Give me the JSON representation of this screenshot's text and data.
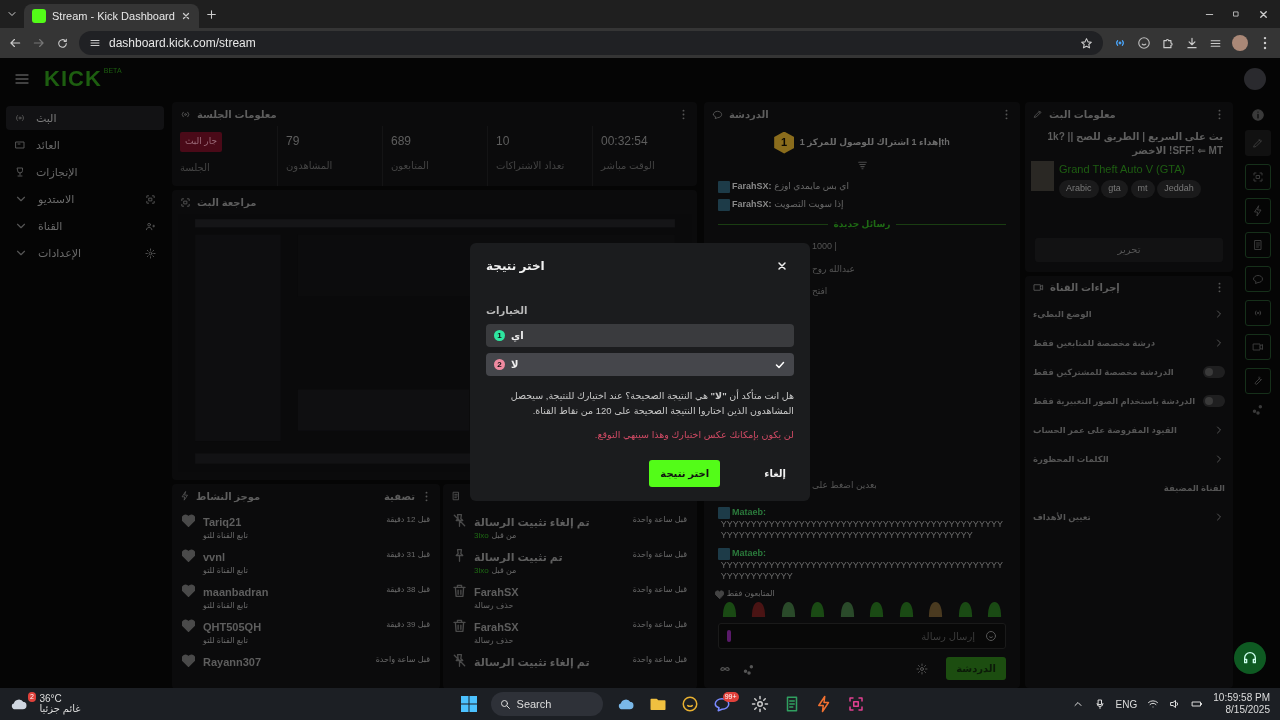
{
  "browser": {
    "tab_title": "Stream - Kick Dashboard",
    "url": "dashboard.kick.com/stream"
  },
  "header": {
    "logo": "KICK",
    "logo_tag": "BETA"
  },
  "sidebar": {
    "items": [
      {
        "label": "البث",
        "kind": "link",
        "selected": true
      },
      {
        "label": "العائد",
        "kind": "link",
        "selected": false
      },
      {
        "label": "الإنجازات",
        "kind": "link",
        "selected": false
      },
      {
        "label": "الاستديو",
        "kind": "group",
        "selected": false
      },
      {
        "label": "القناة",
        "kind": "group",
        "selected": false
      },
      {
        "label": "الإعدادات",
        "kind": "group",
        "selected": false
      }
    ]
  },
  "session": {
    "title": "معلومات الجلسة",
    "stats": [
      {
        "kind": "number",
        "value": "00:32:54",
        "label": "الوقت مباشر"
      },
      {
        "kind": "number",
        "value": "10",
        "label": "تعداد الاشتراكات"
      },
      {
        "kind": "number",
        "value": "689",
        "label": "المتابعون"
      },
      {
        "kind": "number",
        "value": "79",
        "label": "المشاهدون"
      },
      {
        "kind": "badge",
        "value": "جار البث",
        "label": "الجلسة"
      }
    ]
  },
  "preview": {
    "title": "مراجعة البث",
    "kind": "picture"
  },
  "activity": {
    "title": "موجز النشاط",
    "filter": "تصفية",
    "items": [
      {
        "name": "Tariq21",
        "action": "تابع القناة للتو",
        "time": "قبل 12 دقيقة"
      },
      {
        "name": "vvnl",
        "action": "تابع القناة للتو",
        "time": "قبل 31 دقيقة"
      },
      {
        "name": "maanbadran",
        "action": "تابع القناة للتو",
        "time": "قبل 38 دقيقة"
      },
      {
        "name": "QHT505QH",
        "action": "تابع القناة للتو",
        "time": "قبل 39 دقيقة"
      },
      {
        "name": "Rayann307",
        "time": "قبل ساعة واحدة"
      }
    ]
  },
  "mod_log": {
    "items": [
      {
        "kind": "unpin",
        "title": "تم إلغاء تثبيت الرسالة",
        "by": "من قبل",
        "user": "3lxo",
        "time": "قبل ساعة واحدة"
      },
      {
        "kind": "pin",
        "title": "تم تثبيت الرسالة",
        "by": "من قبل",
        "user": "3lxo",
        "time": "قبل ساعة واحدة"
      },
      {
        "kind": "delete",
        "title": "FarahSX",
        "detail": "حذف رسالة",
        "time": "قبل ساعة واحدة"
      },
      {
        "kind": "delete",
        "title": "FarahSX",
        "detail": "حذف رسالة",
        "time": "قبل ساعة واحدة"
      },
      {
        "kind": "unpin",
        "title": "تم إلغاء تثبيت الرسالة",
        "time": "قبل ساعة واحدة"
      }
    ]
  },
  "chat": {
    "title": "الدردشة",
    "pinned": {
      "rank": "1",
      "text": "إهداء 1 اشتراك للوصول للمركز 1th"
    },
    "messages": [
      {
        "kind": "message",
        "user": "FarahSX:",
        "color": "#8a8a8a",
        "text": "اي بس مايمدي اوزع"
      },
      {
        "kind": "message",
        "user": "FarahSX:",
        "color": "#8a8a8a",
        "text": "إذا سويت التصويت"
      },
      {
        "kind": "divider",
        "text": "رسائل جديدة"
      },
      {
        "kind": "fragment",
        "text": "1000 |"
      },
      {
        "kind": "fragment",
        "text": "عبدالله روح"
      },
      {
        "kind": "fragment",
        "text": "افتح"
      },
      {
        "kind": "fragment",
        "text": "بعدين اضغط على"
      },
      {
        "kind": "message",
        "user": "Mataeb:",
        "color": "#2b7a3c",
        "text": "YYYYYYYYYYYYYYYYYYYYYYYYYYYYYYYYYYYYYYYYYYYYYYYYYYYYYYYYYYYYYYYYYYYYYYYYYYYYYYYYYYYYYYYYY"
      },
      {
        "kind": "message",
        "user": "Mataeb:",
        "color": "#2b7a3c",
        "text": "YYYYYYYYYYYYYYYYYYYYYYYYYYYYYYYYYYYYYYYYYYYYYYYYYYYYYYYYYYY"
      }
    ],
    "mode": "المتابعون فقط",
    "placeholder": "إرسال رسالة",
    "send": "الدردشة"
  },
  "stream_info": {
    "title": "معلومات البث",
    "stream_title": "بث على السريع | الطريق للصح |1k? | SFF! ⇐ MT! الاخضر",
    "category": "Grand Theft Auto V (GTA)",
    "tags": [
      "Jeddah",
      "mt",
      "gta",
      "Arabic"
    ],
    "edit": "تحرير"
  },
  "channel_actions": {
    "title": "إجراءات القناة",
    "items": [
      {
        "kind": "link",
        "label": "الوضع البطيء"
      },
      {
        "kind": "link",
        "label": "درشة مخصصة للمتابعين فقط"
      },
      {
        "kind": "toggle",
        "label": "الدردشة مخصصة للمشتركين فقط",
        "on": false
      },
      {
        "kind": "toggle",
        "label": "الدردشة باستخدام الصور التعبيرية فقط",
        "on": false
      },
      {
        "kind": "link",
        "label": "القيود المفروضة على عمر الحساب"
      },
      {
        "kind": "link",
        "label": "الكلمات المحظورة"
      },
      {
        "kind": "section",
        "label": "القناة المضيفة"
      },
      {
        "kind": "link",
        "label": "تعيين الأهداف"
      }
    ]
  },
  "modal": {
    "title": "اختر نتيجة",
    "options_label": "الخيارات",
    "options": [
      {
        "number": "1",
        "label": "اي",
        "color": "#2ee6a0",
        "selected": false
      },
      {
        "number": "2",
        "label": "لا",
        "color": "#f08aa0",
        "selected": true
      }
    ],
    "message": "هل انت متأكد أن **\"لا\"** هي النتيجة الصحيحة؟ عند اختيارك للنتيجة, سيحصل المشاهدون الذين اختاروا النتيجة الصحيحة على 120 من نقاط القناة.",
    "warning": "لن يكون بإمكانك عكس اختيارك وهذا سينهي التوقع.",
    "cancel": "إلغاء",
    "confirm": "اختر نتيجة"
  },
  "taskbar": {
    "temperature": "36°C",
    "weather": "غائم جزئيا",
    "weather_badge": "2",
    "search": "Search",
    "app_badge": "99+",
    "language": "ENG",
    "time": "10:59:58 PM",
    "date": "8/15/2025"
  }
}
